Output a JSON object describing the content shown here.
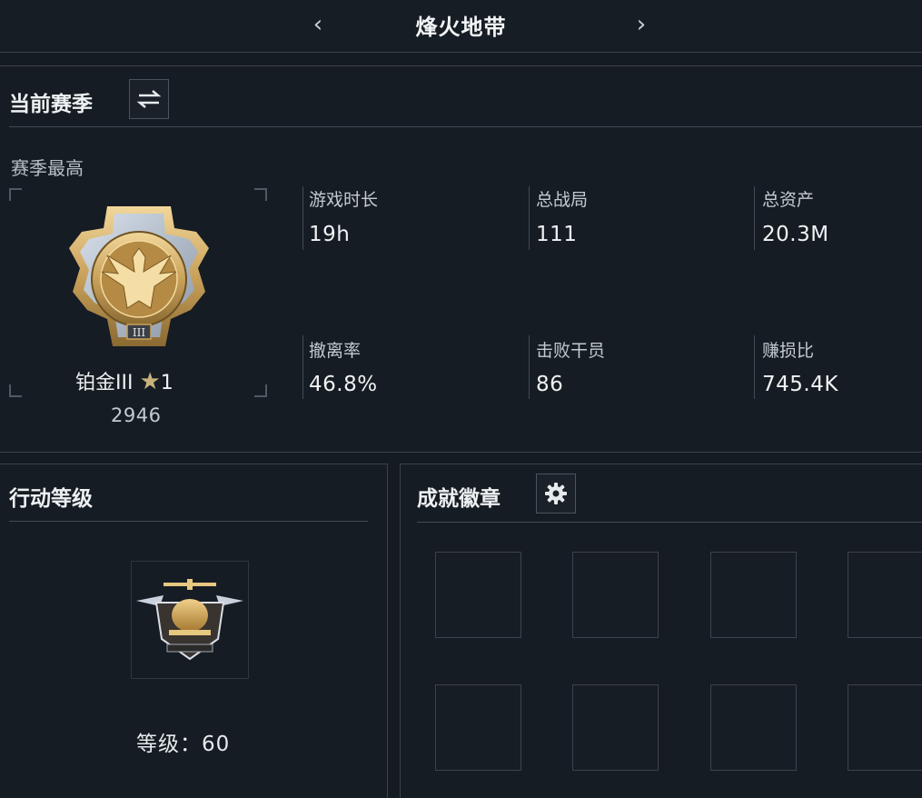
{
  "header": {
    "title": "烽火地带",
    "prev_label": "‹",
    "next_label": "›"
  },
  "season": {
    "section_title": "当前赛季",
    "switch_icon": "swap-icon",
    "best_label": "赛季最高",
    "rank": {
      "name": "铂金III",
      "stars": "1",
      "score": "2946",
      "emblem_icon": "eagle-rank-emblem"
    },
    "stats": [
      {
        "label": "游戏时长",
        "value": "19h"
      },
      {
        "label": "总战局",
        "value": "111"
      },
      {
        "label": "总资产",
        "value": "20.3M"
      },
      {
        "label": "撤离率",
        "value": "46.8%"
      },
      {
        "label": "击败干员",
        "value": "86"
      },
      {
        "label": "赚损比",
        "value": "745.4K"
      }
    ]
  },
  "operation": {
    "section_title": "行动等级",
    "level_label": "等级：",
    "level_value": "60",
    "emblem_icon": "helicopter-emblem"
  },
  "achievements": {
    "section_title": "成就徽章",
    "settings_icon": "gear-icon"
  },
  "colors": {
    "background": "#151b22",
    "divider": "#434b54",
    "gold": "#c9a15a"
  }
}
